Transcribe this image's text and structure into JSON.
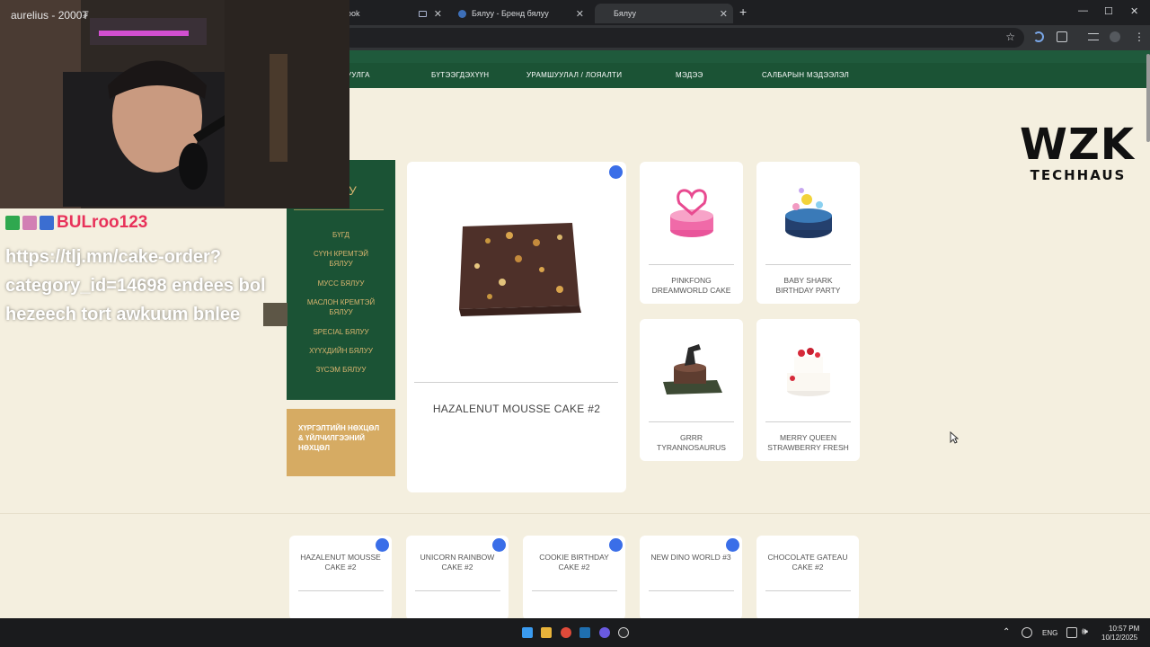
{
  "browser": {
    "tabs": [
      {
        "title": "ook",
        "icon": "doc-icon"
      },
      {
        "title": "",
        "icon": "doc-icon"
      },
      {
        "title": "Бялуу - Бренд бялуу",
        "icon": "site-icon"
      },
      {
        "title": "Бялуу",
        "icon": ""
      }
    ],
    "new_tab": "+",
    "window_controls": [
      "—",
      "☐",
      "✕"
    ]
  },
  "site_nav": {
    "items": [
      "УУЛГА",
      "БҮТЭЭГДЭХҮҮН",
      "УРАМШУУЛАЛ / ЛОЯАЛТИ",
      "МЭДЭЭ",
      "САЛБАРЫН МЭДЭЭЛЭЛ"
    ]
  },
  "watermark": {
    "title": "WZK",
    "subtitle": "TECHHAUS"
  },
  "categories": {
    "heading": "УУ",
    "links": [
      "БҮГД",
      "СҮҮН КРЕМТЭЙ БЯЛУУ",
      "МУСС БЯЛУУ",
      "МАСЛОН КРЕМТЭЙ БЯЛУУ",
      "SPECIAL БЯЛУУ",
      "ХҮҮХДИЙН БЯЛУУ",
      "ЗҮСЭМ БЯЛУУ"
    ],
    "delivery": "ХҮРГЭЛТИЙН НӨХЦӨЛ & ҮЙЛЧИЛГЭЭНИЙ НӨХЦӨЛ"
  },
  "featured": {
    "name": "HAZALENUT MOUSSE CAKE #2"
  },
  "small_products": [
    {
      "name": "PINKFONG DREAMWORLD CAKE"
    },
    {
      "name": "BABY SHARK BIRTHDAY PARTY"
    },
    {
      "name": "GRRR TYRANNOSAURUS"
    },
    {
      "name": "MERRY QUEEN STRAWBERRY FRESH"
    }
  ],
  "bottom_products": [
    {
      "name": "HAZALENUT MOUSSE CAKE #2"
    },
    {
      "name": "UNICORN RAINBOW CAKE #2"
    },
    {
      "name": "COOKIE BIRTHDAY CAKE #2"
    },
    {
      "name": "NEW DINO WORLD #3"
    },
    {
      "name": "CHOCOLATE GATEAU CAKE #2"
    }
  ],
  "overlay": {
    "cam_title": "aurelius - 2000₮",
    "chat_user": "BULroo123",
    "chat_lines": [
      "https://tlj.mn/cake-order?",
      "category_id=14698 endees bol",
      "hezeech tort awkuum bnlee"
    ]
  },
  "taskbar": {
    "language": "ENG",
    "time": "10:57 PM",
    "date": "10/12/2025"
  },
  "colors": {
    "site_green": "#1b5335",
    "gold": "#d6ab63",
    "page_bg": "#f4efdf",
    "badge_blue": "#3a6ee8",
    "chat_name": "#e8325a"
  }
}
